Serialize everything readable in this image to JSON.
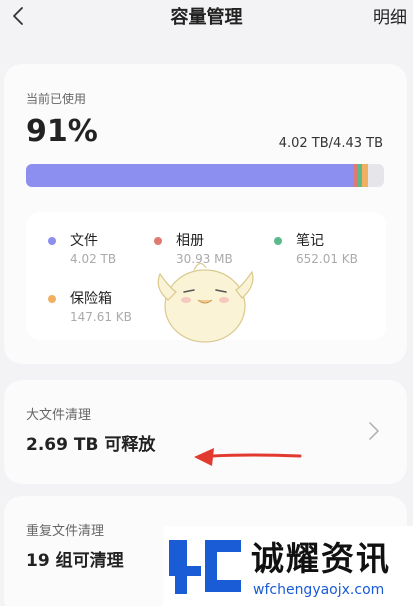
{
  "header": {
    "title": "容量管理",
    "detail_label": "明细"
  },
  "usage": {
    "label": "当前已使用",
    "percent": "91%",
    "amount": "4.02 TB/4.43 TB",
    "used_fraction": 0.91,
    "bar_segments": [
      {
        "name": "文件",
        "color": "#8c8ff0",
        "fraction": 0.915
      },
      {
        "name": "相册",
        "color": "#e07a70",
        "fraction": 0.012
      },
      {
        "name": "笔记",
        "color": "#5cb98c",
        "fraction": 0.012
      },
      {
        "name": "保险箱",
        "color": "#f0b060",
        "fraction": 0.016
      }
    ],
    "unused_color": "#e6e6ea"
  },
  "legend": [
    {
      "name": "文件",
      "size": "4.02 TB",
      "color": "#8c8ff0",
      "icon": "blue-dot-icon"
    },
    {
      "name": "相册",
      "size": "30.93 MB",
      "color": "#e07a70",
      "icon": "red-dot-icon"
    },
    {
      "name": "笔记",
      "size": "652.01 KB",
      "color": "#5cb98c",
      "icon": "green-dot-icon"
    },
    {
      "name": "保险箱",
      "size": "147.61 KB",
      "color": "#f0b060",
      "icon": "orange-dot-icon"
    }
  ],
  "big_file_cleanup": {
    "title": "大文件清理",
    "value": "2.69 TB 可释放"
  },
  "duplicate_cleanup": {
    "title": "重复文件清理",
    "value": "19 组可清理"
  },
  "watermark": {
    "name": "诚耀资讯",
    "url": "wfchengyaojx.com",
    "color": "#1a5bd6"
  }
}
